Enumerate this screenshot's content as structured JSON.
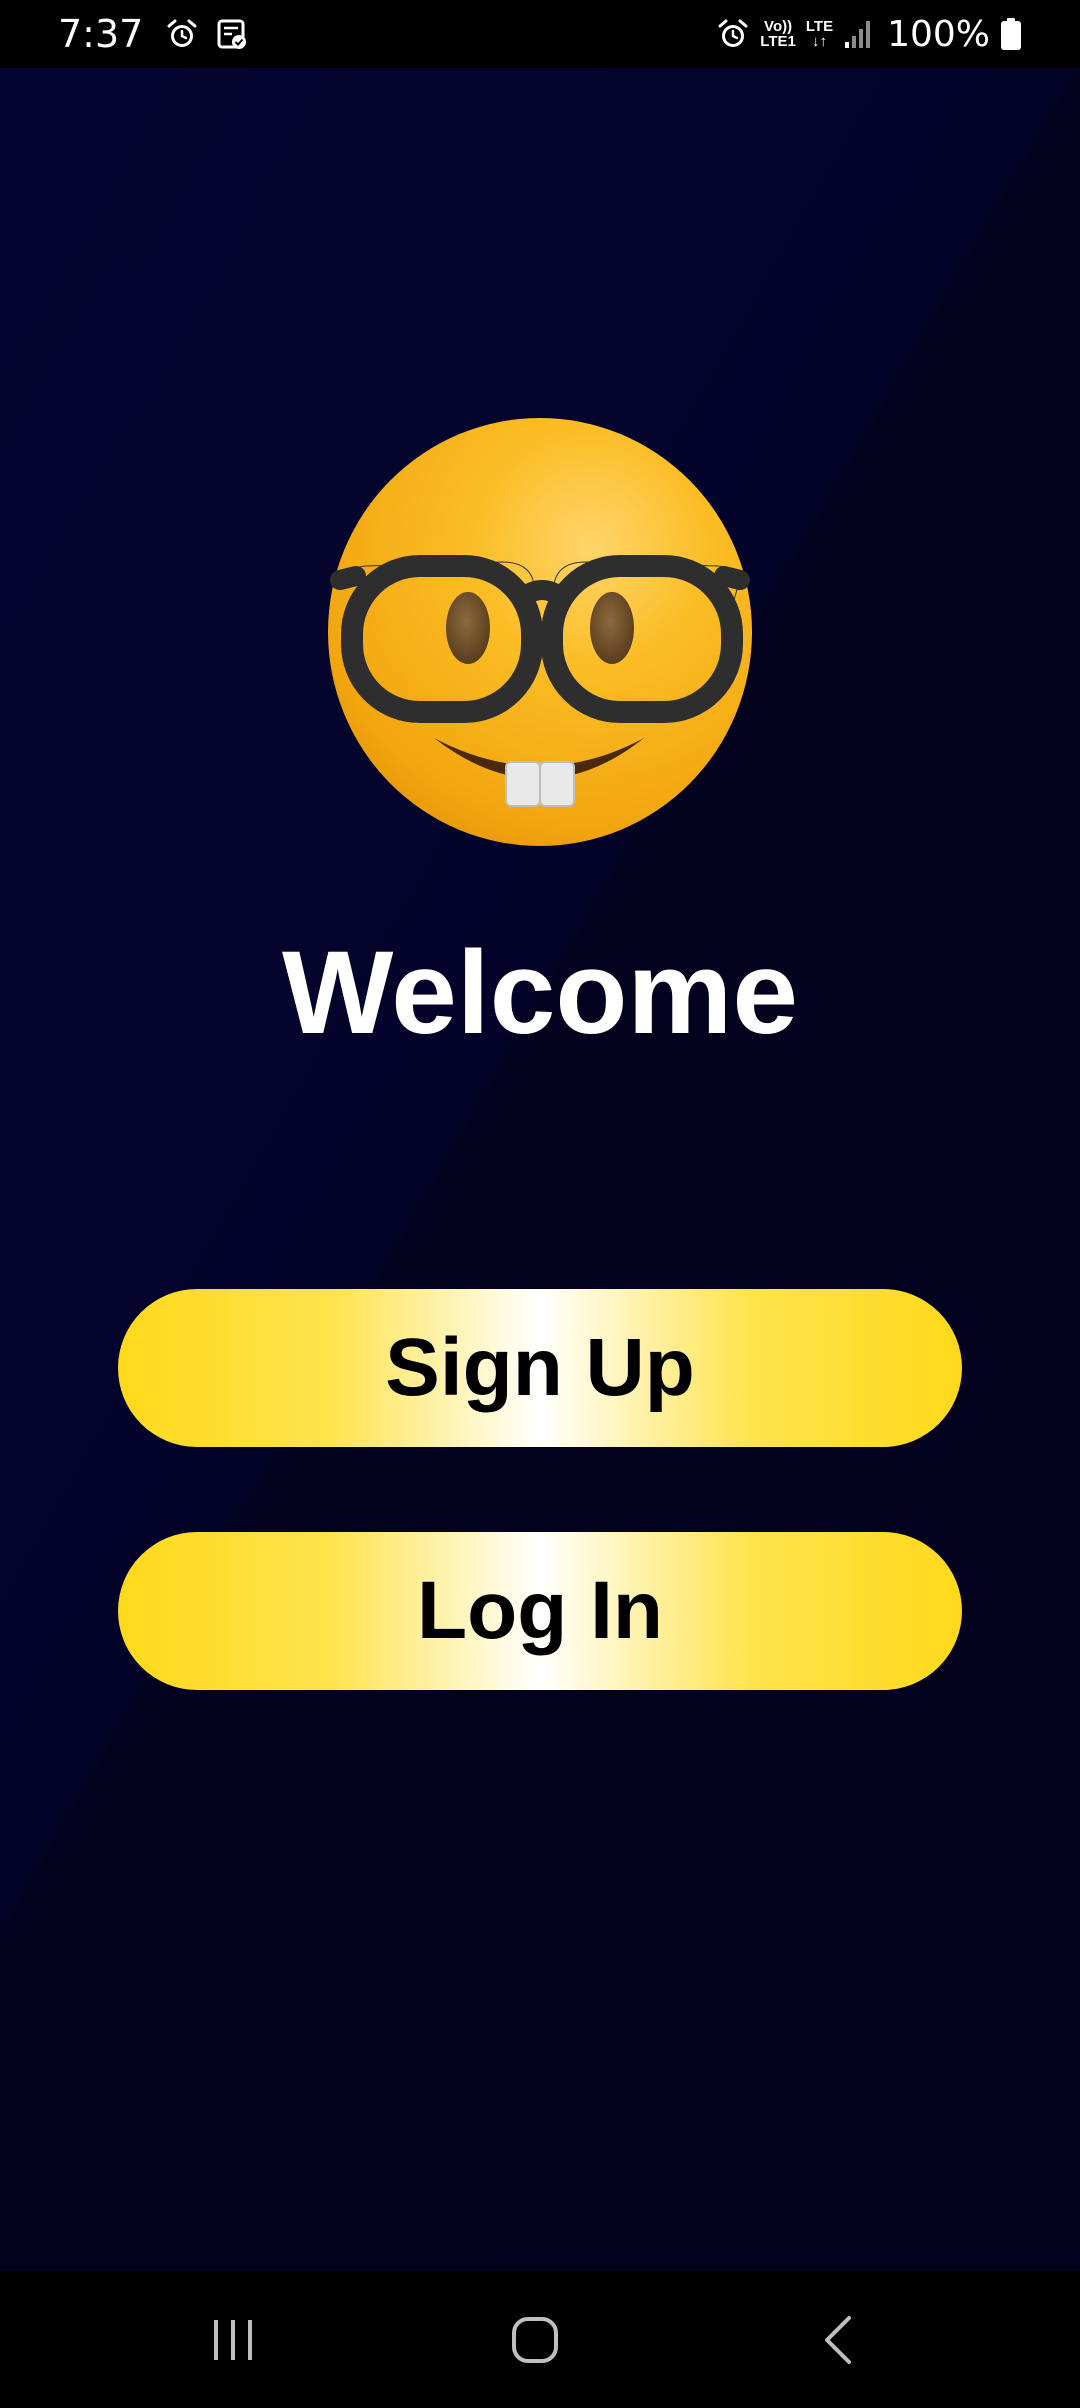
{
  "status_bar": {
    "time": "7:37",
    "left_icons": [
      "alarm-icon",
      "task-check-icon"
    ],
    "right_icons": [
      "alarm-icon",
      "volte-icon",
      "lte-data-icon",
      "signal-icon",
      "battery-icon"
    ],
    "volte_top": "Vo))",
    "volte_bottom": "LTE1",
    "lte_top": "LTE",
    "lte_bottom": "↓↑",
    "battery": "100%"
  },
  "main": {
    "logo_icon": "nerd-face-emoji",
    "title": "Welcome",
    "signup_label": "Sign Up",
    "login_label": "Log In"
  },
  "nav_bar": {
    "icons": [
      "recents-icon",
      "home-icon",
      "back-icon"
    ]
  },
  "colors": {
    "background": "#03032a",
    "button_gold": "#ffd91a",
    "button_highlight": "#ffffff",
    "text_primary": "#ffffff",
    "button_text": "#000000",
    "emoji_yellow": "#f6b41e"
  }
}
